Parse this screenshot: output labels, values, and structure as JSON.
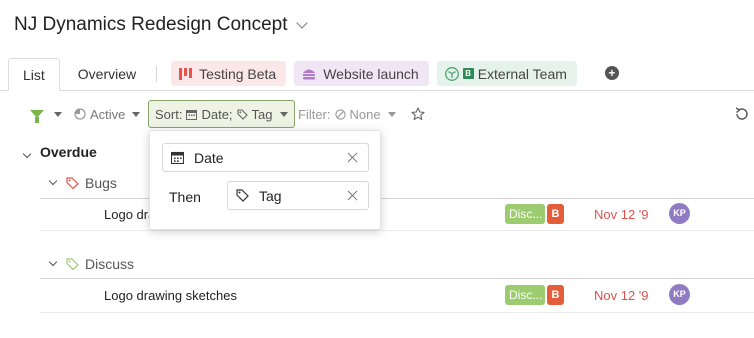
{
  "project": {
    "title": "NJ Dynamics Redesign Concept"
  },
  "tabs": {
    "list": "List",
    "overview": "Overview",
    "chips": [
      {
        "label": "Testing Beta",
        "icon": "kanban-icon",
        "color": "#e5534b"
      },
      {
        "label": "Website launch",
        "icon": "burger-icon",
        "color": "#b07cc6"
      },
      {
        "label": "External Team",
        "badge": "B",
        "icon": "plant-icon",
        "color": "#4fa46f"
      }
    ]
  },
  "toolbar": {
    "active": "Active",
    "sort_prefix": "Sort:",
    "sort_date": "Date;",
    "sort_tag": "Tag",
    "filter_prefix": "Filter:",
    "filter_value": "None"
  },
  "sort_popup": {
    "first": "Date",
    "then_label": "Then",
    "second": "Tag"
  },
  "groups": {
    "overdue": "Overdue",
    "bugs": "Bugs",
    "discuss": "Discuss"
  },
  "tasks": [
    {
      "title": "Logo dra",
      "tag": "Disc...",
      "tag2": "B",
      "due": "Nov 12 '9",
      "assignee": "KP"
    },
    {
      "title": "Logo drawing sketches",
      "tag": "Disc...",
      "tag2": "B",
      "due": "Nov 12 '9",
      "assignee": "KP"
    }
  ],
  "colors": {
    "accent_green": "#7ab648",
    "overdue_red": "#d9534f",
    "tag_green": "#9ccc6f",
    "tag_orange": "#e35d3a",
    "avatar_purple": "#8e7cc3"
  }
}
